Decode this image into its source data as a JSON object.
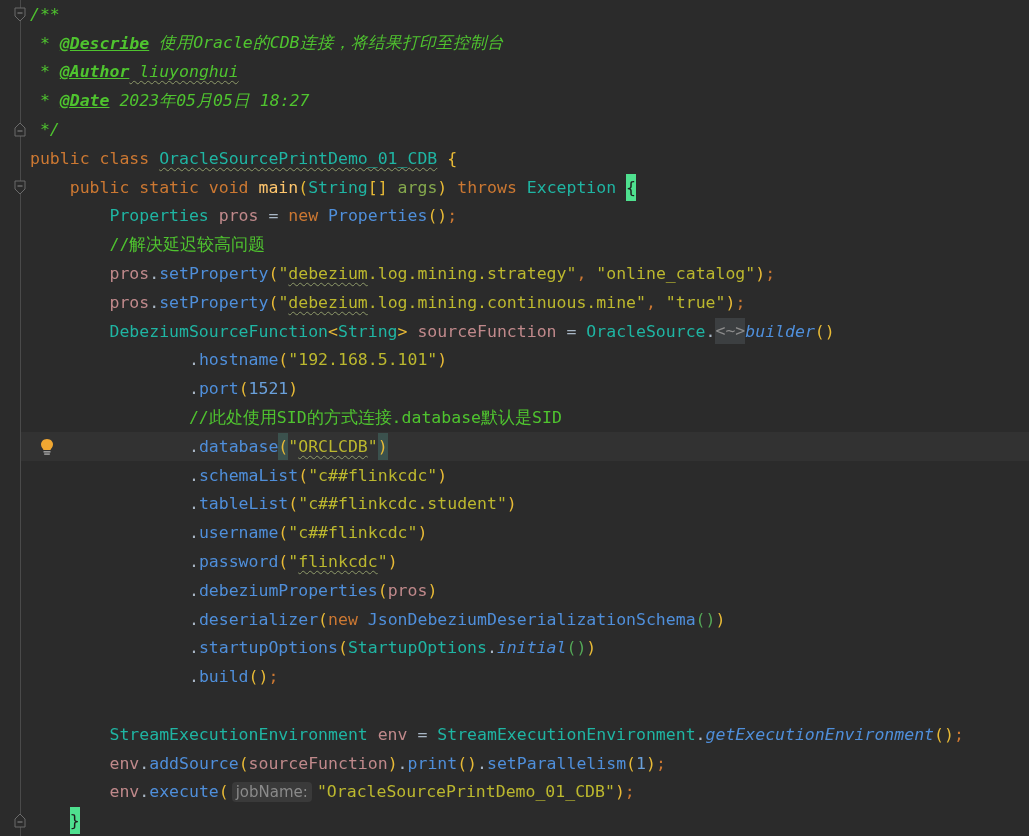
{
  "editor": {
    "lines": [
      {
        "fold": {
          "kind": "start"
        },
        "tokens": [
          {
            "kind": "doc",
            "text": "/**"
          }
        ]
      },
      {
        "tokens": [
          {
            "kind": "doc",
            "text": " * "
          },
          {
            "kind": "doctag",
            "text": "@Describe"
          },
          {
            "kind": "doc",
            "text": " 使用Oracle的CDB连接，将结果打印至控制台"
          }
        ]
      },
      {
        "tokens": [
          {
            "kind": "doc",
            "text": " * "
          },
          {
            "kind": "doctag",
            "text": "@Author"
          },
          {
            "kind": "doc",
            "text": " liuyonghui",
            "typo": true
          }
        ]
      },
      {
        "tokens": [
          {
            "kind": "doc",
            "text": " * "
          },
          {
            "kind": "doctag",
            "text": "@Date"
          },
          {
            "kind": "doc",
            "text": " 2023年05月05日 18:27"
          }
        ]
      },
      {
        "fold": {
          "kind": "end"
        },
        "tokens": [
          {
            "kind": "doc",
            "text": " */"
          }
        ]
      },
      {
        "tokens": [
          {
            "kind": "kw",
            "text": "public class "
          },
          {
            "kind": "type",
            "text": "OracleSourcePrintDemo_01_CDB",
            "typo": true
          },
          {
            "kind": "brace",
            "text": " {"
          }
        ],
        "children": [
          {
            "fold": {
              "kind": "start"
            },
            "tokens": [
              {
                "kind": "kw",
                "text": "public static void "
              },
              {
                "kind": "fn",
                "text": "main"
              },
              {
                "kind": "p1",
                "text": "("
              },
              {
                "kind": "type",
                "text": "String"
              },
              {
                "kind": "p1",
                "text": "[] "
              },
              {
                "kind": "param",
                "text": "args"
              },
              {
                "kind": "p1",
                "text": ")"
              },
              {
                "kind": "kw",
                "text": " throws "
              },
              {
                "kind": "type",
                "text": "Exception "
              },
              {
                "kind": "brace",
                "text": "{",
                "match": true
              }
            ],
            "children": [
              {
                "tokens": [
                  {
                    "kind": "type",
                    "text": "Properties "
                  },
                  {
                    "kind": "var",
                    "text": "pros"
                  },
                  {
                    "kind": "punct",
                    "text": " = "
                  },
                  {
                    "kind": "kw",
                    "text": "new "
                  },
                  {
                    "kind": "method",
                    "text": "Properties"
                  },
                  {
                    "kind": "p1",
                    "text": "()"
                  },
                  {
                    "kind": "semi",
                    "text": ";"
                  }
                ]
              },
              {
                "tokens": [
                  {
                    "kind": "cmt",
                    "text": "//解决延迟较高问题"
                  }
                ]
              },
              {
                "tokens": [
                  {
                    "kind": "var",
                    "text": "pros"
                  },
                  {
                    "kind": "punct",
                    "text": "."
                  },
                  {
                    "kind": "method",
                    "text": "setProperty"
                  },
                  {
                    "kind": "p1",
                    "text": "("
                  },
                  {
                    "kind": "str",
                    "text": "\""
                  },
                  {
                    "kind": "str",
                    "text": "debezium",
                    "typo": true
                  },
                  {
                    "kind": "str",
                    "text": ".log.mining.strategy\""
                  },
                  {
                    "kind": "semi",
                    "text": ", "
                  },
                  {
                    "kind": "str",
                    "text": "\"online_catalog\""
                  },
                  {
                    "kind": "p1",
                    "text": ")"
                  },
                  {
                    "kind": "semi",
                    "text": ";"
                  }
                ]
              },
              {
                "tokens": [
                  {
                    "kind": "var",
                    "text": "pros"
                  },
                  {
                    "kind": "punct",
                    "text": "."
                  },
                  {
                    "kind": "method",
                    "text": "setProperty"
                  },
                  {
                    "kind": "p1",
                    "text": "("
                  },
                  {
                    "kind": "str",
                    "text": "\""
                  },
                  {
                    "kind": "str",
                    "text": "debezium",
                    "typo": true
                  },
                  {
                    "kind": "str",
                    "text": ".log.mining.continuous.mine\""
                  },
                  {
                    "kind": "semi",
                    "text": ", "
                  },
                  {
                    "kind": "str",
                    "text": "\"true\""
                  },
                  {
                    "kind": "p1",
                    "text": ")"
                  },
                  {
                    "kind": "semi",
                    "text": ";"
                  }
                ]
              },
              {
                "tokens": [
                  {
                    "kind": "type",
                    "text": "DebeziumSourceFunction"
                  },
                  {
                    "kind": "p1",
                    "text": "<"
                  },
                  {
                    "kind": "type",
                    "text": "String"
                  },
                  {
                    "kind": "p1",
                    "text": "> "
                  },
                  {
                    "kind": "var",
                    "text": "sourceFunction"
                  },
                  {
                    "kind": "punct",
                    "text": " = "
                  },
                  {
                    "kind": "type",
                    "text": "OracleSource"
                  },
                  {
                    "kind": "punct",
                    "text": "."
                  },
                  {
                    "kind": "folded",
                    "text": "<~>"
                  },
                  {
                    "kind": "smethod",
                    "text": "builder"
                  },
                  {
                    "kind": "p1",
                    "text": "()"
                  }
                ],
                "continuation": [
                  {
                    "tokens": [
                      {
                        "kind": "punct",
                        "text": "."
                      },
                      {
                        "kind": "method",
                        "text": "hostname"
                      },
                      {
                        "kind": "p1",
                        "text": "("
                      },
                      {
                        "kind": "str",
                        "text": "\"192.168.5.101\""
                      },
                      {
                        "kind": "p1",
                        "text": ")"
                      }
                    ]
                  },
                  {
                    "tokens": [
                      {
                        "kind": "punct",
                        "text": "."
                      },
                      {
                        "kind": "method",
                        "text": "port"
                      },
                      {
                        "kind": "p1",
                        "text": "("
                      },
                      {
                        "kind": "num",
                        "text": "1521"
                      },
                      {
                        "kind": "p1",
                        "text": ")"
                      }
                    ]
                  },
                  {
                    "tokens": [
                      {
                        "kind": "cmt",
                        "text": "//此处使用SID的方式连接.database默认是SID"
                      }
                    ]
                  },
                  {
                    "current": true,
                    "tokens": [
                      {
                        "kind": "punct",
                        "text": "."
                      },
                      {
                        "kind": "method",
                        "text": "database"
                      },
                      {
                        "kind": "p1",
                        "text": "(",
                        "match": true
                      },
                      {
                        "kind": "str",
                        "text": "\""
                      },
                      {
                        "kind": "str",
                        "text": "ORCLCDB",
                        "typo": true
                      },
                      {
                        "kind": "str",
                        "text": "\""
                      },
                      {
                        "kind": "p1",
                        "text": ")",
                        "match": true
                      }
                    ]
                  },
                  {
                    "tokens": [
                      {
                        "kind": "punct",
                        "text": "."
                      },
                      {
                        "kind": "method",
                        "text": "schemaList"
                      },
                      {
                        "kind": "p1",
                        "text": "("
                      },
                      {
                        "kind": "str",
                        "text": "\"c##flinkcdc\""
                      },
                      {
                        "kind": "p1",
                        "text": ")"
                      }
                    ]
                  },
                  {
                    "tokens": [
                      {
                        "kind": "punct",
                        "text": "."
                      },
                      {
                        "kind": "method",
                        "text": "tableList"
                      },
                      {
                        "kind": "p1",
                        "text": "("
                      },
                      {
                        "kind": "str",
                        "text": "\"c##flinkcdc.student\""
                      },
                      {
                        "kind": "p1",
                        "text": ")"
                      }
                    ]
                  },
                  {
                    "tokens": [
                      {
                        "kind": "punct",
                        "text": "."
                      },
                      {
                        "kind": "method",
                        "text": "username"
                      },
                      {
                        "kind": "p1",
                        "text": "("
                      },
                      {
                        "kind": "str",
                        "text": "\"c##flinkcdc\""
                      },
                      {
                        "kind": "p1",
                        "text": ")"
                      }
                    ]
                  },
                  {
                    "tokens": [
                      {
                        "kind": "punct",
                        "text": "."
                      },
                      {
                        "kind": "method",
                        "text": "password"
                      },
                      {
                        "kind": "p1",
                        "text": "("
                      },
                      {
                        "kind": "str",
                        "text": "\""
                      },
                      {
                        "kind": "str",
                        "text": "flinkcdc",
                        "typo": true
                      },
                      {
                        "kind": "str",
                        "text": "\""
                      },
                      {
                        "kind": "p1",
                        "text": ")"
                      }
                    ]
                  },
                  {
                    "tokens": [
                      {
                        "kind": "punct",
                        "text": "."
                      },
                      {
                        "kind": "method",
                        "text": "debeziumProperties"
                      },
                      {
                        "kind": "p1",
                        "text": "("
                      },
                      {
                        "kind": "var",
                        "text": "pros"
                      },
                      {
                        "kind": "p1",
                        "text": ")"
                      }
                    ]
                  },
                  {
                    "tokens": [
                      {
                        "kind": "punct",
                        "text": "."
                      },
                      {
                        "kind": "method",
                        "text": "deserializer"
                      },
                      {
                        "kind": "p1",
                        "text": "("
                      },
                      {
                        "kind": "kw",
                        "text": "new "
                      },
                      {
                        "kind": "method",
                        "text": "JsonDebeziumDeserializationSchema"
                      },
                      {
                        "kind": "p2",
                        "text": "()"
                      },
                      {
                        "kind": "p1",
                        "text": ")"
                      }
                    ]
                  },
                  {
                    "tokens": [
                      {
                        "kind": "punct",
                        "text": "."
                      },
                      {
                        "kind": "method",
                        "text": "startupOptions"
                      },
                      {
                        "kind": "p1",
                        "text": "("
                      },
                      {
                        "kind": "type",
                        "text": "StartupOptions"
                      },
                      {
                        "kind": "punct",
                        "text": "."
                      },
                      {
                        "kind": "smethod",
                        "text": "initial"
                      },
                      {
                        "kind": "p2",
                        "text": "()"
                      },
                      {
                        "kind": "p1",
                        "text": ")"
                      }
                    ]
                  },
                  {
                    "tokens": [
                      {
                        "kind": "punct",
                        "text": "."
                      },
                      {
                        "kind": "method",
                        "text": "build"
                      },
                      {
                        "kind": "p1",
                        "text": "()"
                      },
                      {
                        "kind": "semi",
                        "text": ";"
                      }
                    ]
                  }
                ]
              },
              {
                "blank_line_before": true,
                "tokens": [
                  {
                    "kind": "type",
                    "text": "StreamExecutionEnvironment "
                  },
                  {
                    "kind": "var",
                    "text": "env"
                  },
                  {
                    "kind": "punct",
                    "text": " = "
                  },
                  {
                    "kind": "type",
                    "text": "StreamExecutionEnvironment"
                  },
                  {
                    "kind": "punct",
                    "text": "."
                  },
                  {
                    "kind": "smethod",
                    "text": "getExecutionEnvironment"
                  },
                  {
                    "kind": "p1",
                    "text": "()"
                  },
                  {
                    "kind": "semi",
                    "text": ";"
                  }
                ]
              },
              {
                "tokens": [
                  {
                    "kind": "var",
                    "text": "env"
                  },
                  {
                    "kind": "punct",
                    "text": "."
                  },
                  {
                    "kind": "method",
                    "text": "addSource"
                  },
                  {
                    "kind": "p1",
                    "text": "("
                  },
                  {
                    "kind": "var",
                    "text": "sourceFunction"
                  },
                  {
                    "kind": "p1",
                    "text": ")"
                  },
                  {
                    "kind": "punct",
                    "text": "."
                  },
                  {
                    "kind": "method",
                    "text": "print"
                  },
                  {
                    "kind": "p1",
                    "text": "()"
                  },
                  {
                    "kind": "punct",
                    "text": "."
                  },
                  {
                    "kind": "method",
                    "text": "setParallelism"
                  },
                  {
                    "kind": "p1",
                    "text": "("
                  },
                  {
                    "kind": "num",
                    "text": "1"
                  },
                  {
                    "kind": "p1",
                    "text": ")"
                  },
                  {
                    "kind": "semi",
                    "text": ";"
                  }
                ]
              },
              {
                "tokens": [
                  {
                    "kind": "var",
                    "text": "env"
                  },
                  {
                    "kind": "punct",
                    "text": "."
                  },
                  {
                    "kind": "method",
                    "text": "execute"
                  },
                  {
                    "kind": "p1",
                    "text": "("
                  },
                  {
                    "kind": "hint",
                    "text": "jobName:"
                  },
                  {
                    "kind": "str",
                    "text": "\"OracleSourcePrintDemo_01_CDB\""
                  },
                  {
                    "kind": "p1",
                    "text": ")"
                  },
                  {
                    "kind": "semi",
                    "text": ";"
                  }
                ]
              }
            ]
          },
          {
            "fold": {
              "kind": "end"
            },
            "tokens": [
              {
                "kind": "brace",
                "text": "}",
                "match": true
              }
            ]
          }
        ]
      }
    ]
  }
}
